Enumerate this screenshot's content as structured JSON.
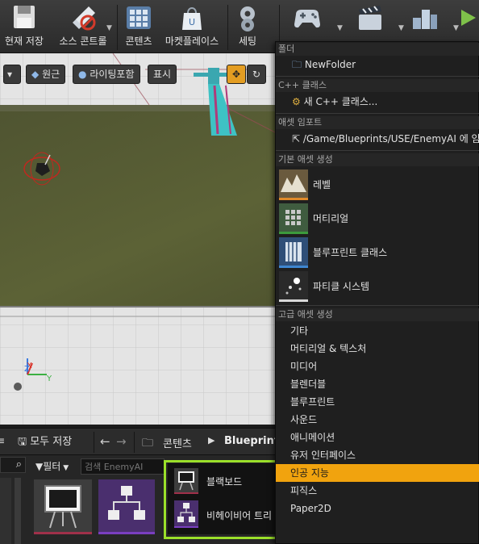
{
  "toolbar": {
    "save": "현재 저장",
    "source_control": "소스 콘트롤",
    "content": "콘텐츠",
    "marketplace": "마켓플레이스",
    "settings": "세팅",
    "blueprints": "블루프린트",
    "cinematics": "시네마틱",
    "build": "빌드"
  },
  "viewport": {
    "view_mode": "원근",
    "lighting": "라이팅포함",
    "show": "표시",
    "axis_x": "X",
    "axis_y": "Y",
    "axis_z": "Z"
  },
  "content_browser": {
    "save_all": "모두 저장",
    "path_root": "콘텐츠",
    "path_current": "Blueprints",
    "filter": "필터",
    "search_placeholder": "검색 EnemyAI",
    "assets": [
      {
        "label": "블랙보드"
      },
      {
        "label": "비헤이비어 트리"
      }
    ]
  },
  "menu": {
    "folder_header": "폴더",
    "new_folder": "NewFolder",
    "cpp_header": "C++ 클래스",
    "new_cpp": "새 C++ 클래스...",
    "import_header": "애셋 임포트",
    "import_path": "/Game/Blueprints/USE/EnemyAI 에 임포트",
    "basic_header": "기본 애셋 생성",
    "basic_items": [
      "레벨",
      "머티리얼",
      "블루프린트 클래스",
      "파티클 시스템"
    ],
    "advanced_header": "고급 애셋 생성",
    "advanced_items": [
      "기타",
      "머티리얼 & 텍스처",
      "미디어",
      "블렌더블",
      "블루프린트",
      "사운드",
      "애니메이션",
      "유저 인터페이스",
      "인공 지능",
      "피직스",
      "Paper2D"
    ],
    "selected_item": "인공 지능"
  },
  "colors": {
    "menu_highlight": "#f1a30e",
    "selection_outline": "#9be02a",
    "blackboard_accent": "#a0304a",
    "behavior_tree_accent": "#7a3fc0"
  }
}
